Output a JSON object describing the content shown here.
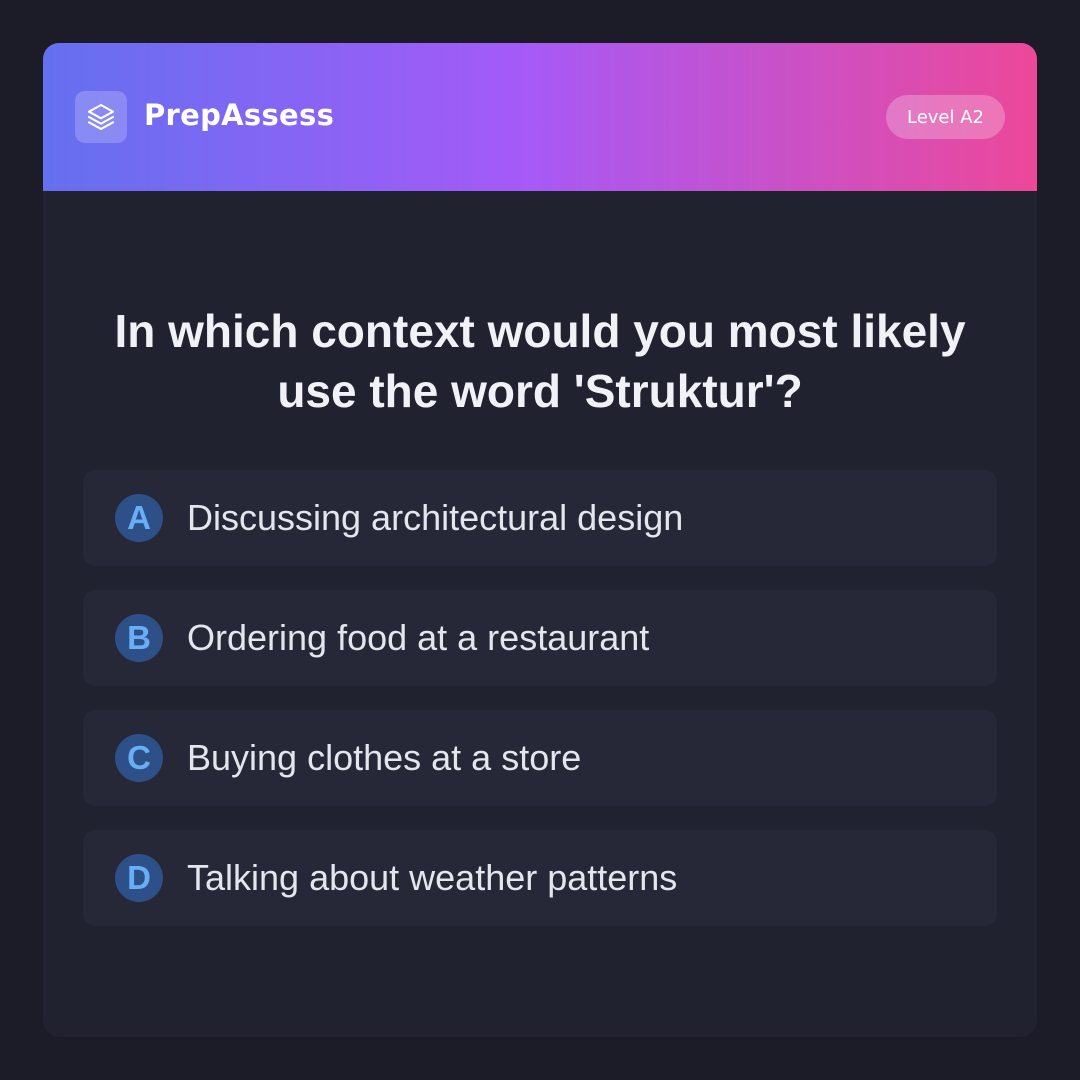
{
  "app": {
    "brand": "PrepAssess",
    "logo_icon": "layers-icon",
    "level_badge": "Level A2"
  },
  "colors": {
    "background": "#1b1c28",
    "card": "#202230",
    "header_gradient": [
      "#6470f0",
      "#a55af8",
      "#ec4899"
    ],
    "option_bg": "#262837",
    "letter_circle": "#2d5088",
    "letter_text": "#68aef5"
  },
  "quiz": {
    "question": "In which context would you most likely use the word 'Struktur'?",
    "options": [
      {
        "letter": "A",
        "text": "Discussing architectural design"
      },
      {
        "letter": "B",
        "text": "Ordering food at a restaurant"
      },
      {
        "letter": "C",
        "text": "Buying clothes at a store"
      },
      {
        "letter": "D",
        "text": "Talking about weather patterns"
      }
    ]
  }
}
